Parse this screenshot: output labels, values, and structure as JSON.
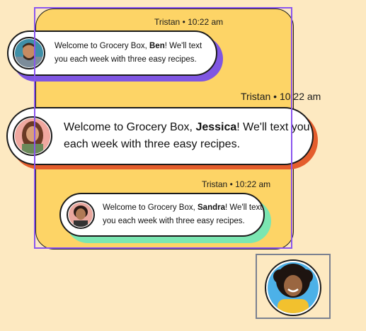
{
  "messages": [
    {
      "sender": "Tristan",
      "separator": "•",
      "time": "10:22 am",
      "text_before": "Welcome to Grocery Box, ",
      "name": "Ben",
      "text_after": "! We'll text you each week with three easy recipes.",
      "avatar_icon": "ben-avatar-photo",
      "shadow_color": "#7f56e2"
    },
    {
      "sender": "Tristan",
      "separator": "•",
      "time": "10:22 am",
      "text_before": "Welcome to Grocery Box, ",
      "name": "Jessica",
      "text_after": "! We'll text you each week with three easy recipes.",
      "avatar_icon": "jessica-avatar-photo",
      "shadow_color": "#e45d2c"
    },
    {
      "sender": "Tristan",
      "separator": "•",
      "time": "10:22 am",
      "text_before": "Welcome to Grocery Box, ",
      "name": "Sandra",
      "text_after": "! We'll text you each week with three easy recipes.",
      "avatar_icon": "sandra-avatar-photo",
      "shadow_color": "#7be6b2"
    }
  ],
  "selected_avatar": {
    "icon": "woman-avatar-photo"
  },
  "colors": {
    "page_background": "#fde9c1",
    "frame_background": "#fdd466",
    "selection_outline": "#8a55ef"
  }
}
